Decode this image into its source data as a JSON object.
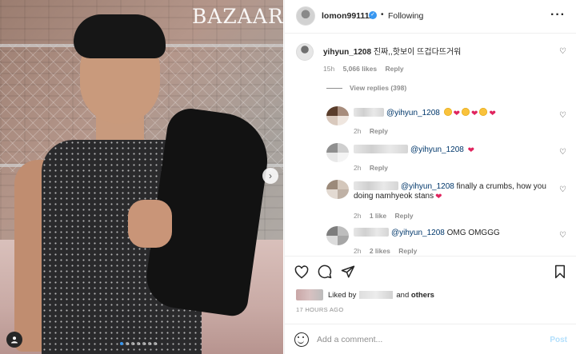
{
  "photo": {
    "brand": "BAZAAR"
  },
  "header": {
    "username": "lomon991111",
    "verified_icon": "verified-badge-icon",
    "separator": "•",
    "following": "Following",
    "more_icon": "ellipsis-icon"
  },
  "main_comment": {
    "username": "yihyun_1208",
    "text": "진짜,,핫보이 뜨겁다뜨거워",
    "time": "15h",
    "likes": "5,066 likes",
    "reply": "Reply",
    "view_replies": "View replies (398)"
  },
  "replies": [
    {
      "mention": "@yihyun_1208",
      "text": "",
      "emoji": [
        "face",
        "heart",
        "face",
        "heart",
        "face",
        "heart"
      ],
      "time": "2h",
      "likes": "",
      "reply": "Reply"
    },
    {
      "mention": "@yihyun_1208",
      "text": "",
      "emoji": [
        "heart"
      ],
      "time": "2h",
      "likes": "",
      "reply": "Reply"
    },
    {
      "mention": "@yihyun_1208",
      "text": " finally a crumbs, how you",
      "text2": "doing namhyeok stans",
      "emoji": [
        "heart"
      ],
      "time": "2h",
      "likes": "1 like",
      "reply": "Reply"
    },
    {
      "mention": "@yihyun_1208",
      "text": " OMG OMGGG",
      "emoji": [],
      "time": "2h",
      "likes": "2 likes",
      "reply": "Reply"
    }
  ],
  "actions": {
    "like_icon": "heart-outline-icon",
    "comment_icon": "comment-icon",
    "share_icon": "send-icon",
    "save_icon": "bookmark-icon"
  },
  "liked_by": {
    "prefix": "Liked by",
    "suffix": "and",
    "others": "others"
  },
  "timestamp": "17 HOURS AGO",
  "composer": {
    "placeholder": "Add a comment...",
    "post": "Post"
  },
  "colors": {
    "accent": "#3897f0",
    "post_disabled": "#b2dffc",
    "heart_red": "#e0245e",
    "muted": "#8e8e8e"
  }
}
